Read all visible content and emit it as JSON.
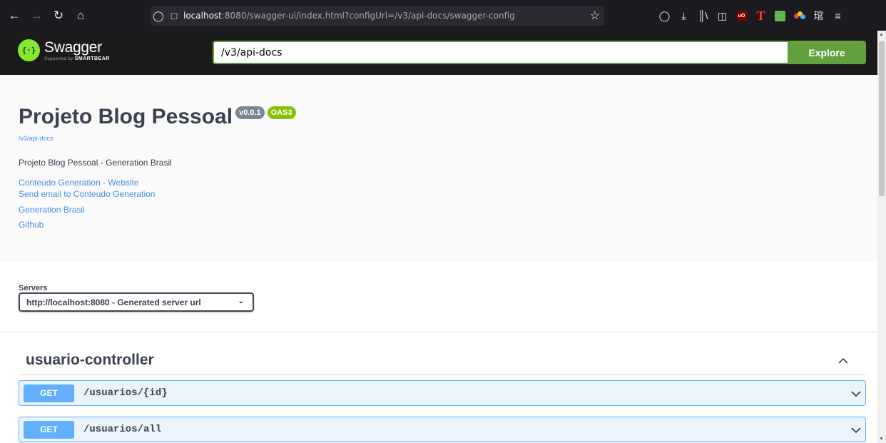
{
  "browser": {
    "url_host": "localhost",
    "url_rest": ":8080/swagger-ui/index.html?configUrl=/v3/api-docs/swagger-config",
    "icons": [
      "back-icon",
      "forward-icon",
      "reload-icon",
      "home-icon",
      "tracking-shield-icon",
      "page-icon",
      "bookmark-star-icon",
      "pocket-icon",
      "download-icon",
      "library-icon",
      "sidebar-icon",
      "ublock-icon",
      "extension-t-icon",
      "extension-green-icon",
      "extension-dots-icon",
      "translate-icon",
      "menu-icon"
    ]
  },
  "topbar": {
    "logo_name": "Swagger",
    "logo_supported_by": "Supported by",
    "logo_brand": "SMARTBEAR",
    "spec_input_value": "/v3/api-docs",
    "explore_label": "Explore",
    "colors": {
      "background": "#1b1b1b",
      "accent": "#62a03f",
      "logo": "#85ea2d"
    }
  },
  "info": {
    "title": "Projeto Blog Pessoal",
    "version_badge": "v0.0.1",
    "oas_badge": "OAS3",
    "spec_url": "/v3/api-docs",
    "description": "Projeto Blog Pessoal - Generation Brasil",
    "links": {
      "website": "Conteudo Generation - Website",
      "email": "Send email to Conteudo Generation",
      "license": "Generation Brasil",
      "external_docs": "Github"
    }
  },
  "servers": {
    "label": "Servers",
    "selected": "http://localhost:8080 - Generated server url"
  },
  "controller": {
    "name": "usuario-controller",
    "operations": [
      {
        "method": "GET",
        "path": "/usuarios/{id}"
      },
      {
        "method": "GET",
        "path": "/usuarios/all"
      }
    ],
    "colors": {
      "get_method": "#61affe",
      "get_background": "#ebf3fb"
    }
  }
}
